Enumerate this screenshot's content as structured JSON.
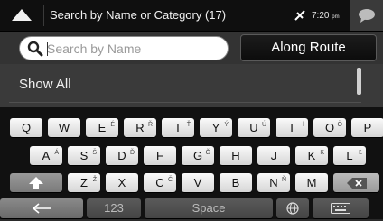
{
  "header": {
    "title": "Search by Name or Category (17)",
    "time": "7:20",
    "time_suffix": "pm"
  },
  "search": {
    "placeholder": "Search by Name",
    "value": "",
    "along_route_label": "Along Route"
  },
  "list": {
    "items": [
      {
        "label": "Show All"
      }
    ]
  },
  "keyboard": {
    "row1": [
      {
        "k": "Q",
        "s": ""
      },
      {
        "k": "W",
        "s": ""
      },
      {
        "k": "E",
        "s": "É"
      },
      {
        "k": "R",
        "s": "Ř"
      },
      {
        "k": "T",
        "s": "Ť"
      },
      {
        "k": "Y",
        "s": "Ý"
      },
      {
        "k": "U",
        "s": "Ú"
      },
      {
        "k": "I",
        "s": "Í"
      },
      {
        "k": "O",
        "s": "Ö"
      },
      {
        "k": "P",
        "s": ""
      }
    ],
    "row2": [
      {
        "k": "A",
        "s": "Á"
      },
      {
        "k": "S",
        "s": "Š"
      },
      {
        "k": "D",
        "s": "Ď"
      },
      {
        "k": "F",
        "s": ""
      },
      {
        "k": "G",
        "s": "Ğ"
      },
      {
        "k": "H",
        "s": ""
      },
      {
        "k": "J",
        "s": ""
      },
      {
        "k": "K",
        "s": "Ķ"
      },
      {
        "k": "L",
        "s": "Ľ"
      }
    ],
    "row3": [
      {
        "k": "Z",
        "s": "Ž"
      },
      {
        "k": "X",
        "s": ""
      },
      {
        "k": "C",
        "s": "Č"
      },
      {
        "k": "V",
        "s": ""
      },
      {
        "k": "B",
        "s": ""
      },
      {
        "k": "N",
        "s": "Ň"
      },
      {
        "k": "M",
        "s": ""
      }
    ],
    "numbers_label": "123",
    "space_label": "Space"
  },
  "colors": {
    "topbar": "#0f0f0f",
    "key_face": "#f2f2f2",
    "dark_key": "#7a7a7a"
  },
  "icons": {
    "back": "up-arrow-icon",
    "satellite": "satellite-icon",
    "message": "speech-bubble-icon",
    "search": "magnifier-icon",
    "shift": "shift-arrow-icon",
    "delete": "backspace-icon",
    "left": "left-arrow-icon",
    "globe": "globe-icon",
    "keyboard": "keyboard-icon"
  }
}
